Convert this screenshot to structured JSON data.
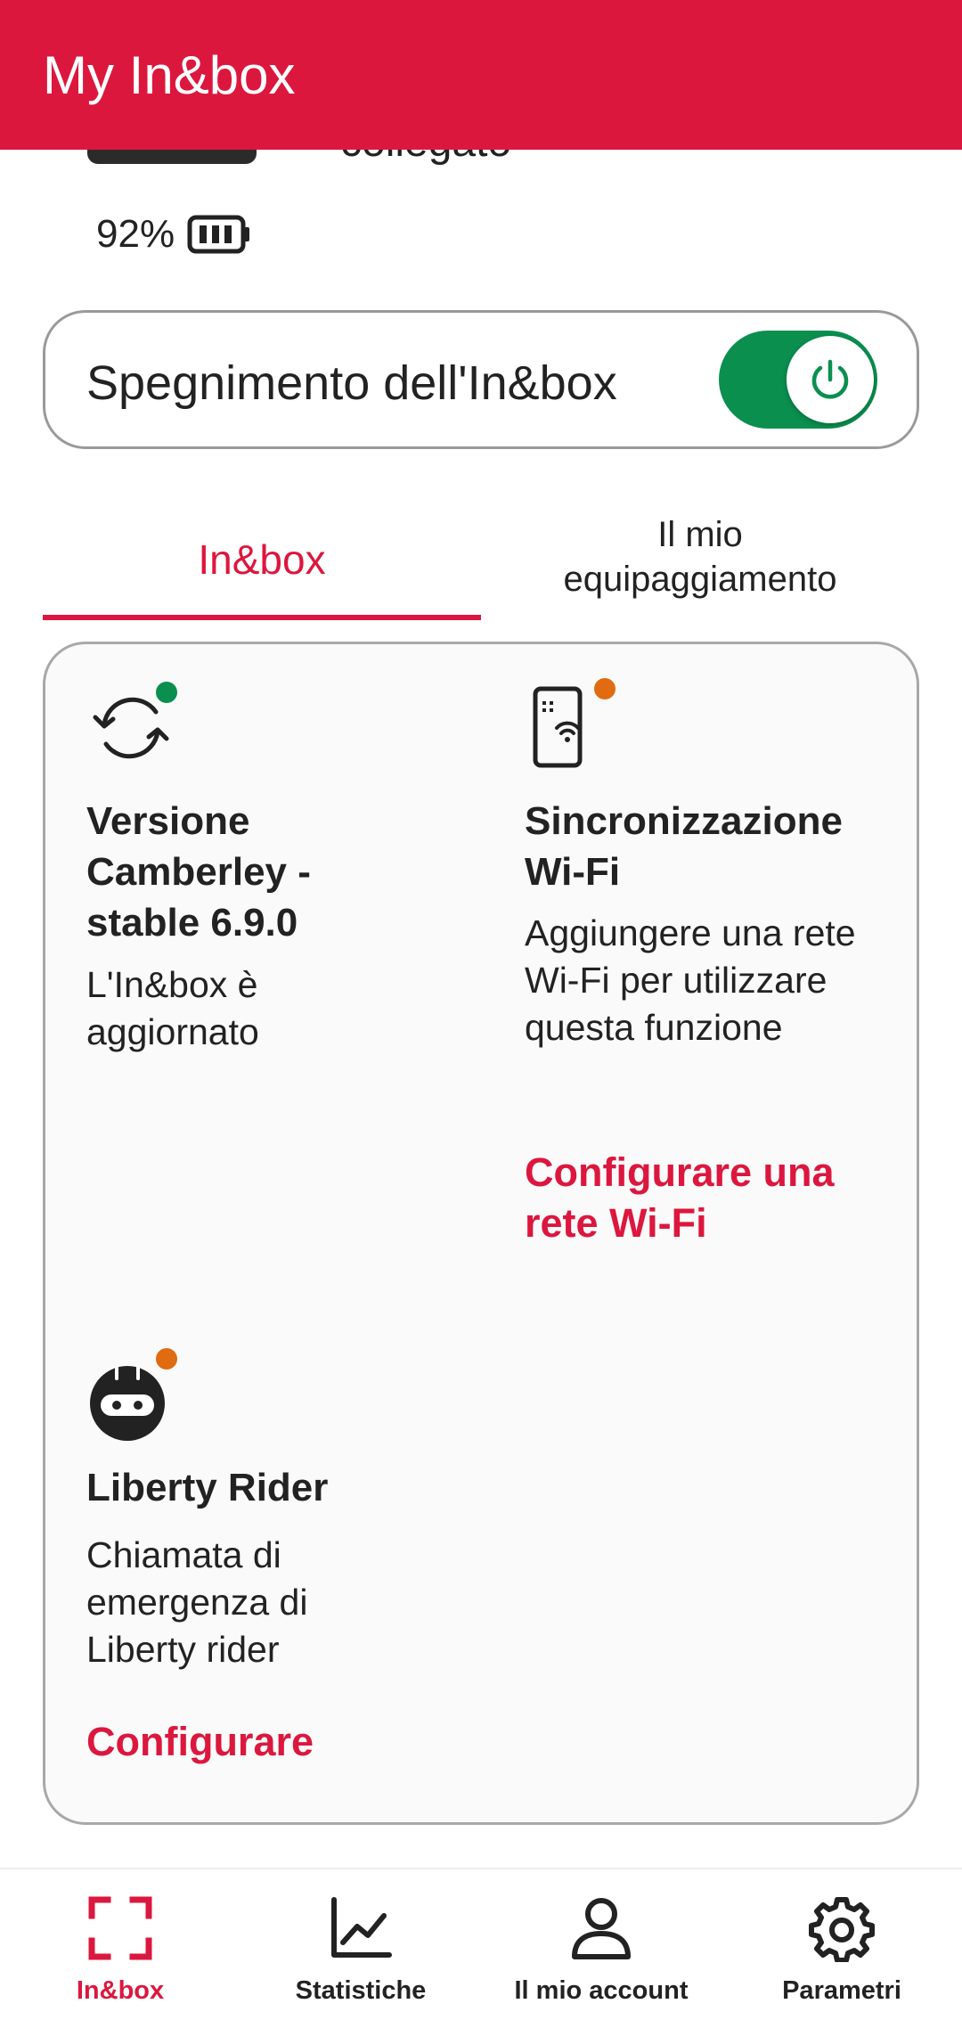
{
  "app_bar": {
    "title": "My In&box"
  },
  "device": {
    "status": "collegato",
    "battery_percent": "92%"
  },
  "power": {
    "label": "Spegnimento dell'In&box",
    "toggle_on": true
  },
  "tabs": [
    {
      "label": "In&box",
      "active": true
    },
    {
      "label": "Il mio equipaggiamento",
      "active": false
    }
  ],
  "features": {
    "version": {
      "title": "Versione Camberley - stable 6.9.0",
      "description": "L'In&box è aggiornato",
      "status_color": "#0a8f4f"
    },
    "wifi": {
      "title": "Sincronizzazione Wi-Fi",
      "description": "Aggiungere una rete Wi-Fi per utilizzare questa funzione",
      "link": "Configurare una rete Wi-Fi",
      "status_color": "#e06b10"
    },
    "liberty": {
      "title": "Liberty Rider",
      "description": "Chiamata di emergenza di Liberty rider",
      "link": "Configurare",
      "status_color": "#e06b10"
    }
  },
  "bottom_nav": [
    {
      "label": "In&box",
      "icon": "frame-icon",
      "active": true
    },
    {
      "label": "Statistiche",
      "icon": "chart-icon",
      "active": false
    },
    {
      "label": "Il mio account",
      "icon": "person-icon",
      "active": false
    },
    {
      "label": "Parametri",
      "icon": "gear-icon",
      "active": false
    }
  ],
  "colors": {
    "brand": "#dc173e",
    "toggle_on": "#0a8f4f"
  }
}
